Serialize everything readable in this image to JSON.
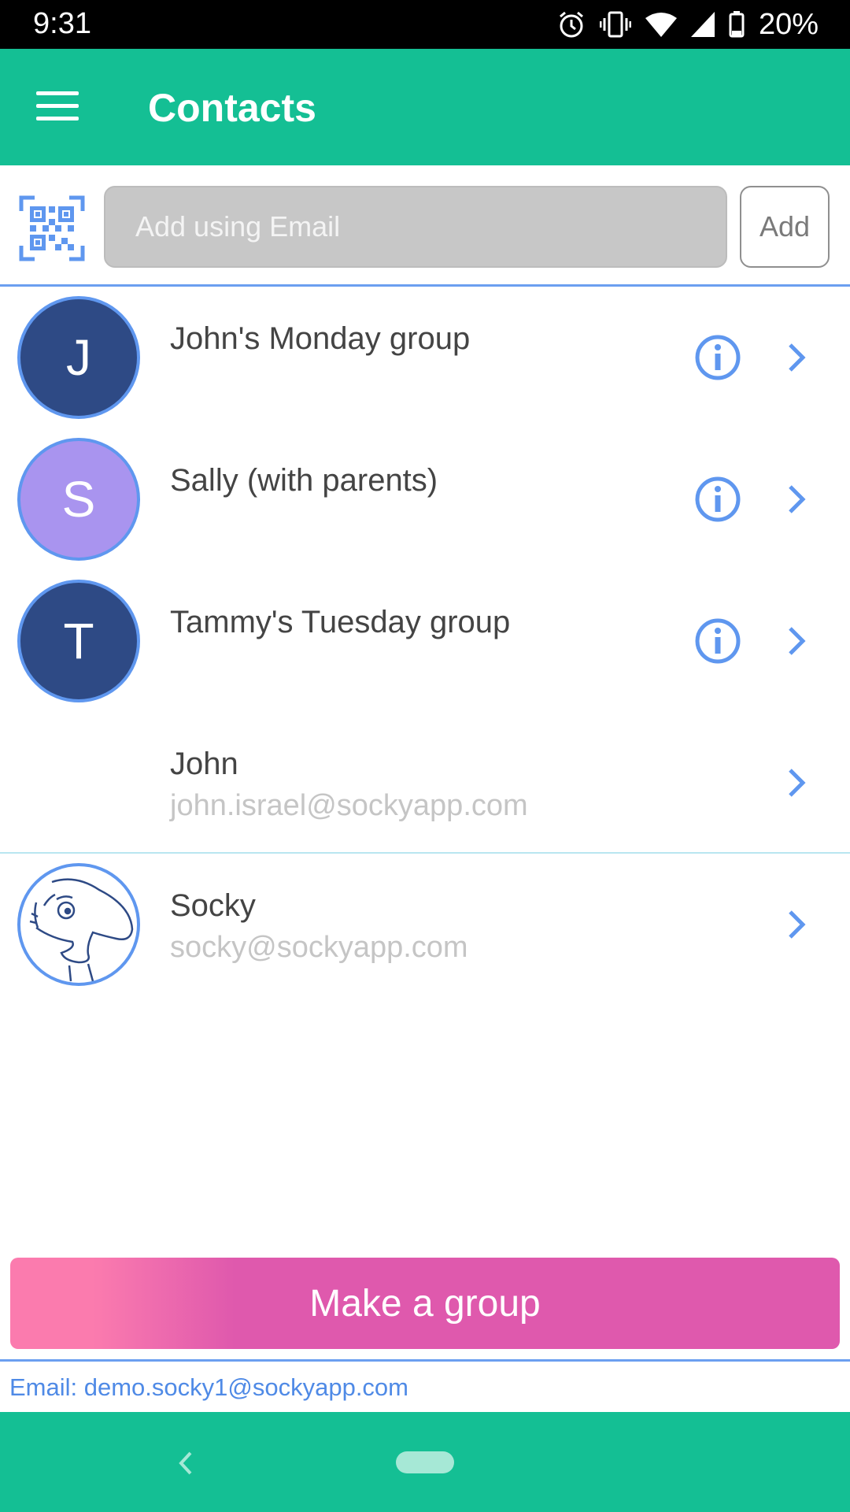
{
  "status_bar": {
    "time": "9:31",
    "battery_percent": "20%",
    "icons": [
      "alarm-icon",
      "vibrate-icon",
      "wifi-icon",
      "cell-signal-icon",
      "battery-icon"
    ]
  },
  "app_bar": {
    "title": "Contacts",
    "menu_icon": "hamburger-menu-icon",
    "color": "#14bf94"
  },
  "add_contact": {
    "qr_icon": "qr-code-icon",
    "placeholder": "Add using Email",
    "add_label": "Add"
  },
  "contacts": [
    {
      "initial": "J",
      "name": "John's Monday group",
      "email": "",
      "avatar_color": "#2e4a85",
      "has_info": true
    },
    {
      "initial": "S",
      "name": "Sally (with parents)",
      "email": "",
      "avatar_color": "#a994ef",
      "has_info": true
    },
    {
      "initial": "T",
      "name": "Tammy's Tuesday group",
      "email": "",
      "avatar_color": "#2e4a85",
      "has_info": true
    },
    {
      "initial": "",
      "name": "John",
      "email": "john.israel@sockyapp.com",
      "avatar_color": "",
      "has_info": false
    },
    {
      "initial": "",
      "name": "Socky",
      "email": "socky@sockyapp.com",
      "avatar_color": "",
      "has_info": false,
      "avatar_icon": "socky-mascot-icon"
    }
  ],
  "make_group": {
    "label": "Make a group"
  },
  "footer": {
    "email_text": "Email: demo.socky1@sockyapp.com"
  },
  "colors": {
    "accent_blue": "#5f97ef",
    "pink_gradient_start": "#fb7bae",
    "pink_gradient_end": "#df59ad"
  }
}
